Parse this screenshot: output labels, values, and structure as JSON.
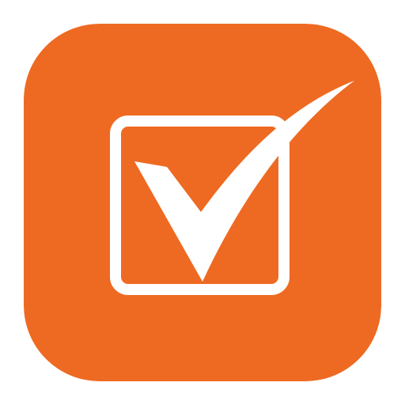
{
  "app_icon": {
    "icon": "checkbox-checkmark-icon",
    "background_color": "#EE6A22",
    "glyph_color": "#FFFFFF",
    "checked": true
  }
}
